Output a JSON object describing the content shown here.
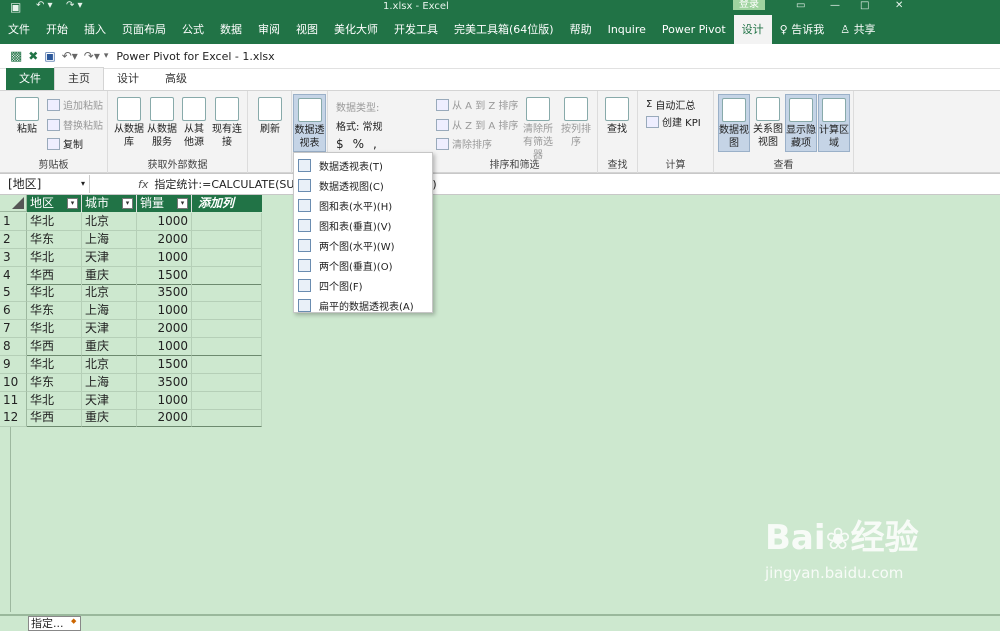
{
  "excel": {
    "filename": "1.xlsx",
    "app": "Excel",
    "title_sep": " - ",
    "login": "登录",
    "menu": [
      "文件",
      "开始",
      "插入",
      "页面布局",
      "公式",
      "数据",
      "审阅",
      "视图",
      "美化大师",
      "开发工具",
      "完美工具箱(64位版)",
      "帮助",
      "Inquire",
      "Power Pivot",
      "设计",
      "告诉我",
      "共享"
    ]
  },
  "pp": {
    "title": "Power Pivot for Excel - 1.xlsx",
    "tabs": [
      "文件",
      "主页",
      "设计",
      "高级"
    ],
    "ribbon": {
      "clipboard": {
        "paste": "粘贴",
        "append": "追加粘贴",
        "replace": "替换粘贴",
        "copy": "复制",
        "label": "剪贴板"
      },
      "external": {
        "from_db": "从数据库",
        "from_service": "从数据服务",
        "from_other": "从其他源",
        "existing": "现有连接",
        "label": "获取外部数据"
      },
      "refresh": "刷新",
      "pivot": "数据透视表",
      "format": {
        "datatype": "数据类型:",
        "format": "格式: 常规",
        "currency": "$",
        "percent": "%",
        "comma": ","
      },
      "sort": {
        "asc": "从 A 到 Z 排序",
        "desc": "从 Z 到 A 排序",
        "clear_sort": "清除排序",
        "clear_filters": "清除所有筛选器",
        "sort_by_col": "按列排序",
        "label": "排序和筛选"
      },
      "find": {
        "btn": "查找",
        "label": "查找"
      },
      "calc": {
        "autosum": "自动汇总",
        "kpi": "创建 KPI",
        "label": "计算"
      },
      "view": {
        "data_view": "数据视图",
        "diagram": "关系图视图",
        "show_hidden": "显示隐藏项",
        "calc_area": "计算区域",
        "label": "查看"
      }
    },
    "namebox": "[地区]",
    "fx": "fx",
    "formula": "指定统计:=CALCULATE(SUM",
    "formula_tail": "')",
    "grid": {
      "headers": [
        "地区",
        "城市",
        "销量"
      ],
      "add_column": "添加列",
      "rows": [
        [
          "1",
          "华北",
          "北京",
          "1000"
        ],
        [
          "2",
          "华东",
          "上海",
          "2000"
        ],
        [
          "3",
          "华北",
          "天津",
          "1000"
        ],
        [
          "4",
          "华西",
          "重庆",
          "1500"
        ],
        [
          "5",
          "华北",
          "北京",
          "3500"
        ],
        [
          "6",
          "华东",
          "上海",
          "1000"
        ],
        [
          "7",
          "华北",
          "天津",
          "2000"
        ],
        [
          "8",
          "华西",
          "重庆",
          "1000"
        ],
        [
          "9",
          "华北",
          "北京",
          "1500"
        ],
        [
          "10",
          "华东",
          "上海",
          "3500"
        ],
        [
          "11",
          "华北",
          "天津",
          "1000"
        ],
        [
          "12",
          "华西",
          "重庆",
          "2000"
        ]
      ]
    },
    "dropdown": [
      "数据透视表(T)",
      "数据透视图(C)",
      "图和表(水平)(H)",
      "图和表(垂直)(V)",
      "两个图(水平)(W)",
      "两个图(垂直)(O)",
      "四个图(F)",
      "扁平的数据透视表(A)"
    ],
    "sheet_tab": "指定..."
  },
  "watermark": {
    "brand": "Bai",
    "brand2": "经验",
    "url": "jingyan.baidu.com"
  },
  "colors": {
    "excel_green": "#217346",
    "grid_bg": "#cde8cf"
  }
}
